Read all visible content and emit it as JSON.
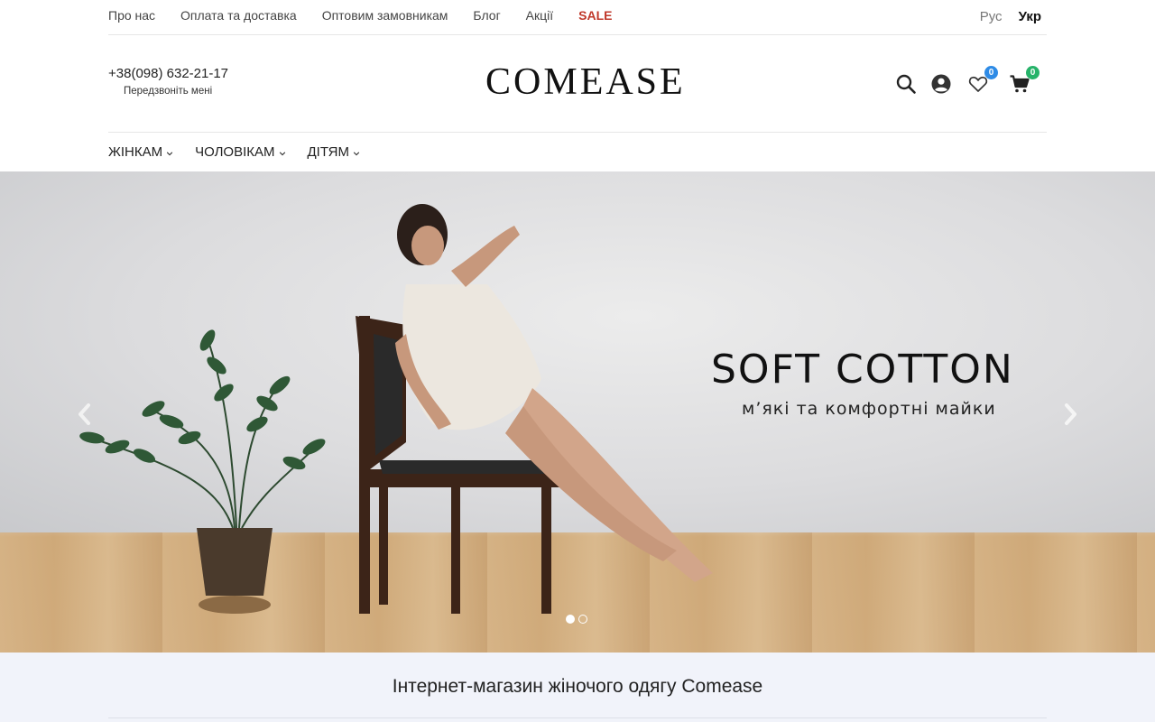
{
  "topnav": {
    "items": [
      "Про нас",
      "Оплата та доставка",
      "Оптовим замовникам",
      "Блог",
      "Акції"
    ],
    "sale": "SALE"
  },
  "lang": {
    "ru": "Рус",
    "uk": "Укр"
  },
  "header": {
    "phone": "+38(098) 632-21-17",
    "callback": "Передзвоніть мені",
    "logo": "COMEASE",
    "wishlist_count": "0",
    "cart_count": "0",
    "icons": [
      "search-icon",
      "user-icon",
      "heart-icon",
      "cart-icon"
    ]
  },
  "catmenu": {
    "items": [
      "ЖІНКАМ",
      "ЧОЛОВІКАМ",
      "ДІТЯМ"
    ]
  },
  "hero": {
    "title": "SOFT COTTON",
    "subtitle": "м’які та комфортні майки",
    "slides": 2,
    "active_slide": 1
  },
  "intro": {
    "heading": "Інтернет-магазин жіночого одягу Comease"
  },
  "colors": {
    "sale": "#c0392b",
    "badge_wishlist": "#2e8be6",
    "badge_cart": "#27b36a",
    "intro_bg": "#f1f3fa"
  }
}
